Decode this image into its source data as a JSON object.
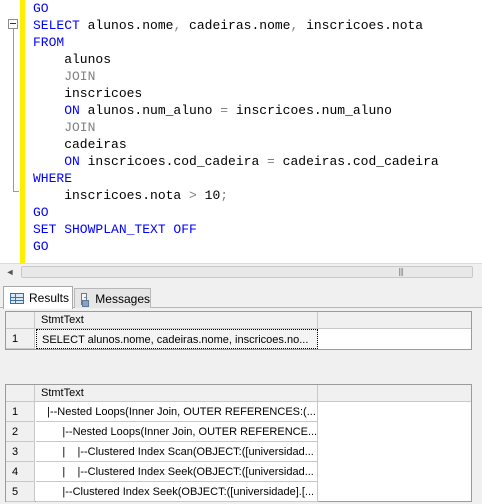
{
  "editor": {
    "lines": [
      {
        "parts": [
          {
            "t": "GO",
            "c": "kw"
          }
        ]
      },
      {
        "parts": [
          {
            "t": "SELECT",
            "c": "kw"
          },
          {
            "t": " alunos.nome",
            "c": ""
          },
          {
            "t": ",",
            "c": "gray"
          },
          {
            "t": " cadeiras.nome",
            "c": ""
          },
          {
            "t": ",",
            "c": "gray"
          },
          {
            "t": " inscricoes.nota",
            "c": ""
          }
        ]
      },
      {
        "parts": [
          {
            "t": "FROM",
            "c": "kw"
          }
        ]
      },
      {
        "parts": [
          {
            "t": "    alunos",
            "c": ""
          }
        ]
      },
      {
        "parts": [
          {
            "t": "    JOIN",
            "c": "gray"
          }
        ]
      },
      {
        "parts": [
          {
            "t": "    inscricoes",
            "c": ""
          }
        ]
      },
      {
        "parts": [
          {
            "t": "    ON",
            "c": "kw"
          },
          {
            "t": " alunos.num_aluno ",
            "c": ""
          },
          {
            "t": "=",
            "c": "gray"
          },
          {
            "t": " inscricoes.num_aluno",
            "c": ""
          }
        ]
      },
      {
        "parts": [
          {
            "t": "    JOIN",
            "c": "gray"
          }
        ]
      },
      {
        "parts": [
          {
            "t": "    cadeiras",
            "c": ""
          }
        ]
      },
      {
        "parts": [
          {
            "t": "    ON",
            "c": "kw"
          },
          {
            "t": " inscricoes.cod_cadeira ",
            "c": ""
          },
          {
            "t": "=",
            "c": "gray"
          },
          {
            "t": " cadeiras.cod_cadeira",
            "c": ""
          }
        ]
      },
      {
        "parts": [
          {
            "t": "WHERE",
            "c": "kw"
          }
        ]
      },
      {
        "parts": [
          {
            "t": "    inscricoes.nota ",
            "c": ""
          },
          {
            "t": ">",
            "c": "gray"
          },
          {
            "t": " 10",
            "c": ""
          },
          {
            "t": ";",
            "c": "gray"
          }
        ]
      },
      {
        "parts": [
          {
            "t": "GO",
            "c": "kw"
          }
        ]
      },
      {
        "parts": [
          {
            "t": "SET SHOWPLAN_TEXT OFF",
            "c": "kw"
          }
        ]
      },
      {
        "parts": [
          {
            "t": "GO",
            "c": "kw"
          }
        ]
      }
    ],
    "scroll_left_icon": "◄",
    "scroll_grip": "|||"
  },
  "tabs": {
    "results_label": "Results",
    "messages_label": "Messages",
    "results_icon": "grid-icon",
    "messages_icon": "messages-icon"
  },
  "grid1": {
    "column_header": "StmtText",
    "rows": [
      {
        "num": "1",
        "text": "SELECT alunos.nome, cadeiras.nome, inscricoes.no..."
      }
    ]
  },
  "grid2": {
    "column_header": "StmtText",
    "rows": [
      {
        "num": "1",
        "text": "  |--Nested Loops(Inner Join, OUTER REFERENCES:(..."
      },
      {
        "num": "2",
        "text": "       |--Nested Loops(Inner Join, OUTER REFERENCE..."
      },
      {
        "num": "3",
        "text": "       |    |--Clustered Index Scan(OBJECT:([universidad..."
      },
      {
        "num": "4",
        "text": "       |    |--Clustered Index Seek(OBJECT:([universidad..."
      },
      {
        "num": "5",
        "text": "       |--Clustered Index Seek(OBJECT:([universidade].[..."
      }
    ]
  },
  "colors": {
    "keyword": "#0000ff",
    "operator": "#808080",
    "change_marker": "#ffee00"
  }
}
